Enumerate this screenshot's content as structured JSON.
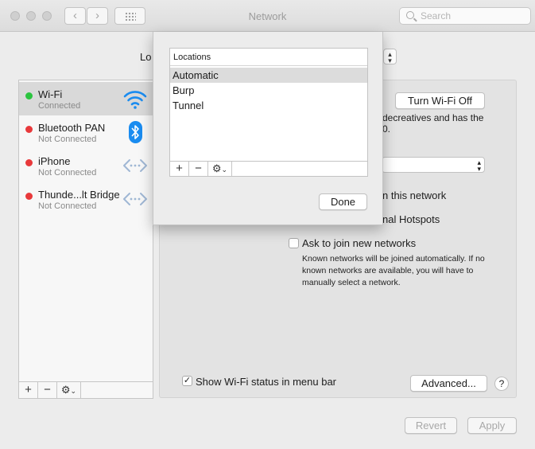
{
  "window": {
    "title": "Network",
    "search_placeholder": "Search",
    "back_glyph": "‹",
    "forward_glyph": "›"
  },
  "location": {
    "label_visible": "Lo"
  },
  "services": [
    {
      "name": "Wi-Fi",
      "status": "Connected",
      "status_color": "#2bc43f",
      "icon": "wifi-icon"
    },
    {
      "name": "Bluetooth PAN",
      "status": "Not Connected",
      "status_color": "#e8393b",
      "icon": "bluetooth-icon"
    },
    {
      "name": "iPhone",
      "status": "Not Connected",
      "status_color": "#e8393b",
      "icon": "dots-arrows-icon"
    },
    {
      "name": "Thunde...lt Bridge",
      "status": "Not Connected",
      "status_color": "#e8393b",
      "icon": "dots-arrows-icon"
    }
  ],
  "sidebar_tools": {
    "add": "+",
    "remove": "−",
    "gear": "⚙",
    "gear_caret": "⌄"
  },
  "panel": {
    "turn_wifi_off": "Turn Wi-Fi Off",
    "status_partial_1": "decreatives and has the",
    "status_partial_2": "0.",
    "option_join_partial": "n this network",
    "option_hotspots_partial": "nal Hotspots",
    "ask_to_join_label": "Ask to join new networks",
    "ask_to_join_note": "Known networks will be joined automatically. If no known networks are available, you will have to manually select a network.",
    "show_status_label": "Show Wi-Fi status in menu bar",
    "show_status_checked": "✓",
    "advanced_label": "Advanced...",
    "help_label": "?"
  },
  "footer": {
    "revert": "Revert",
    "apply": "Apply"
  },
  "locations_sheet": {
    "header": "Locations",
    "items": [
      "Automatic",
      "Burp",
      "Tunnel"
    ],
    "selected_index": 0,
    "add": "+",
    "remove": "−",
    "gear": "⚙",
    "gear_caret": "⌄",
    "done": "Done"
  },
  "colors": {
    "connected": "#2bc43f",
    "disconnected": "#e8393b",
    "accent_blue": "#1a8cf0"
  }
}
